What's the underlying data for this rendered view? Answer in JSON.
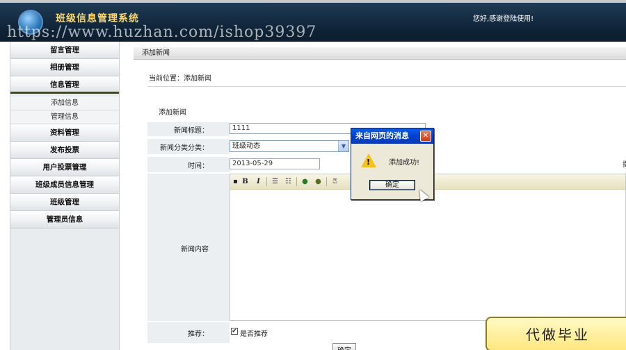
{
  "header": {
    "app_title": "班级信息管理系统",
    "welcome": "您好,感谢登陆使用!",
    "watermark": "https://www.huzhan.com/ishop39397"
  },
  "sidebar": {
    "items": [
      {
        "label": "留言管理"
      },
      {
        "label": "相册管理"
      },
      {
        "label": "信息管理",
        "open": true,
        "children": [
          "添加信息",
          "管理信息"
        ]
      },
      {
        "label": "资料管理"
      },
      {
        "label": "发布投票"
      },
      {
        "label": "用户投票管理"
      },
      {
        "label": "班级成员信息管理"
      },
      {
        "label": "班级管理"
      },
      {
        "label": "管理员信息"
      }
    ]
  },
  "main": {
    "crumb_title": "添加新闻",
    "location": "当前位置：添加新闻",
    "form_heading": "添加新闻",
    "fields": {
      "title_label": "新闻标题：",
      "title_value": "1111",
      "category_label": "新闻分类分类：",
      "category_value": "班级动态",
      "time_label": "时间：",
      "time_value": "2013-05-29",
      "content_label": "新闻内容",
      "recommend_label": "推荐：",
      "recommend_checkbox_label": "是否推荐",
      "recommend_checked": true
    },
    "editor_toolbar": [
      "B",
      "I",
      "ordered-list-icon",
      "unordered-list-icon",
      "link-icon",
      "unlink-icon",
      "help-icon"
    ],
    "submit_label": "确定",
    "right_edge_char": "提"
  },
  "dialog": {
    "title": "来自网页的消息",
    "message": "添加成功!",
    "ok_label": "确定",
    "icon": "warning-icon"
  },
  "banner": {
    "text": "代做毕业"
  },
  "colors": {
    "header_bg": "#0f2337",
    "title_gold": "#ffd86b",
    "dialog_title": "#0a5ee8",
    "banner_bg": "#ffe680"
  }
}
